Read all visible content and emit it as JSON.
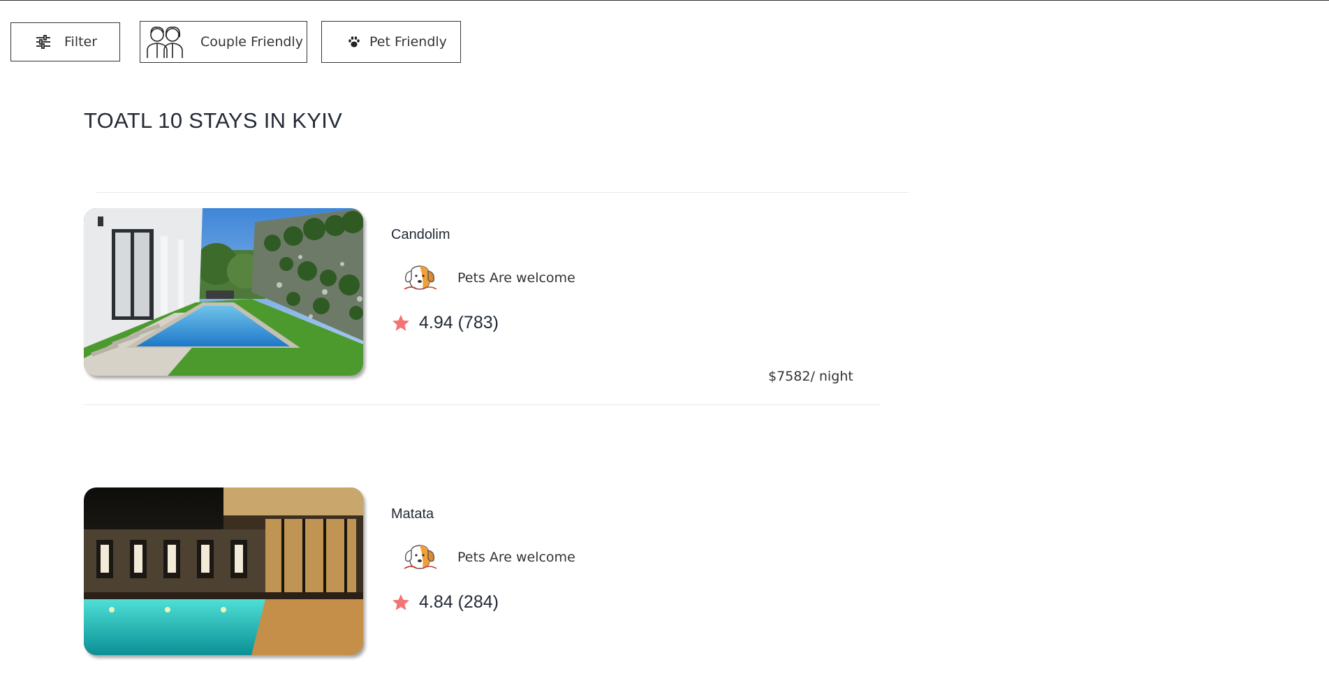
{
  "filters": {
    "filter_label": "Filter",
    "couple_label": "Couple Friendly",
    "pet_label": "Pet Friendly"
  },
  "results": {
    "title": "TOATL 10 STAYS IN KYIV"
  },
  "stays": [
    {
      "name": "Candolim",
      "amenity": "Pets Are welcome",
      "rating": "4.94 (783)",
      "price": "$7582/ night",
      "image": "villa-pool-garden"
    },
    {
      "name": "Matata",
      "amenity": "Pets Are welcome",
      "rating": "4.84 (284)",
      "image": "night-pool-villa"
    }
  ],
  "colors": {
    "star": "#f27474",
    "text": "#222a36",
    "border": "#333333",
    "divider": "#e8e8e8"
  },
  "icons": {
    "filter": "sliders-icon",
    "couple": "couple-icon",
    "pet": "paw-icon",
    "amenity": "dog-icon",
    "rating": "star-icon"
  }
}
